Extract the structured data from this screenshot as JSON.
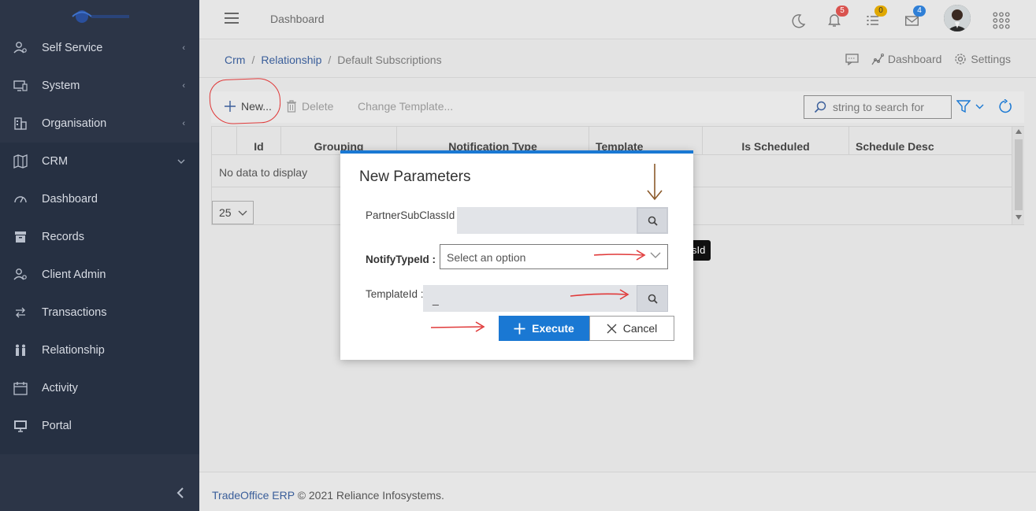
{
  "sidebar": {
    "items": [
      {
        "label": "Self Service",
        "icon": "user-cog-icon",
        "has_chevron": true
      },
      {
        "label": "System",
        "icon": "monitor-icon",
        "has_chevron": true
      },
      {
        "label": "Organisation",
        "icon": "building-icon",
        "has_chevron": true
      },
      {
        "label": "CRM",
        "icon": "map-icon",
        "has_chevron": true
      },
      {
        "label": "Dashboard",
        "icon": "gauge-icon"
      },
      {
        "label": "Records",
        "icon": "archive-icon"
      },
      {
        "label": "Client Admin",
        "icon": "user-cog-icon"
      },
      {
        "label": "Transactions",
        "icon": "swap-icon"
      },
      {
        "label": "Relationship",
        "icon": "people-icon"
      },
      {
        "label": "Activity",
        "icon": "calendar-icon"
      },
      {
        "label": "Portal",
        "icon": "portal-icon"
      }
    ],
    "chevron_right": "‹",
    "chevron_down": "⌄"
  },
  "topbar": {
    "title": "Dashboard",
    "notifications": {
      "bell": "5",
      "list": "0",
      "mail": "4"
    },
    "badge_colors": {
      "bell": "#d9534f",
      "list": "#e0a800",
      "mail": "#2f7fd6"
    }
  },
  "breadcrumb": {
    "items": [
      "Crm",
      "Relationship",
      "Default Subscriptions"
    ],
    "sep": "/",
    "actions": {
      "dashboard": "Dashboard",
      "settings": "Settings"
    }
  },
  "toolbar": {
    "new_label": "New...",
    "delete_label": "Delete",
    "change_template_label": "Change Template...",
    "search_placeholder": "string to search for"
  },
  "grid": {
    "columns": [
      "Id",
      "Grouping",
      "Notification Type",
      "Template",
      "Is Scheduled",
      "Schedule Desc"
    ],
    "empty_text": "No data to display",
    "page_size": "25"
  },
  "tooltip_fragment": "sId",
  "modal": {
    "title": "New Parameters",
    "fields": {
      "partner_sub_class": {
        "label": "PartnerSubClassId :",
        "value": ""
      },
      "notify_type": {
        "label": "NotifyTypeId :",
        "placeholder": "Select an option"
      },
      "template": {
        "label": "TemplateId :",
        "value": "_"
      }
    },
    "execute_label": "Execute",
    "cancel_label": "Cancel"
  },
  "footer": {
    "brand": "TradeOffice ERP",
    "text": "© 2021 Reliance Infosystems."
  },
  "colors": {
    "sidebar_bg": "#2c3547",
    "primary": "#1a78d3",
    "link": "#3a5e9a",
    "annotation_red": "#e03a3a",
    "annotation_brown": "#8b5a2b"
  }
}
